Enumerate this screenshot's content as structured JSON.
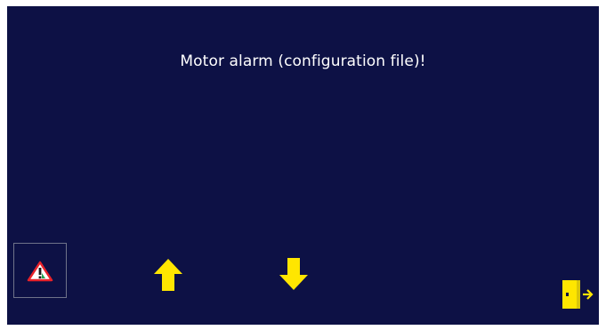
{
  "screen": {
    "background_color": "#0d1145",
    "message": "Motor alarm (configuration file)!"
  },
  "buttons": {
    "alarm": {
      "icon": "warning-triangle-icon",
      "accent": "#e8222a"
    },
    "up": {
      "icon": "arrow-up-icon",
      "color": "#ffe600"
    },
    "down": {
      "icon": "arrow-down-icon",
      "color": "#ffe600"
    },
    "exit": {
      "icon": "exit-door-icon",
      "color": "#ffe600"
    }
  }
}
